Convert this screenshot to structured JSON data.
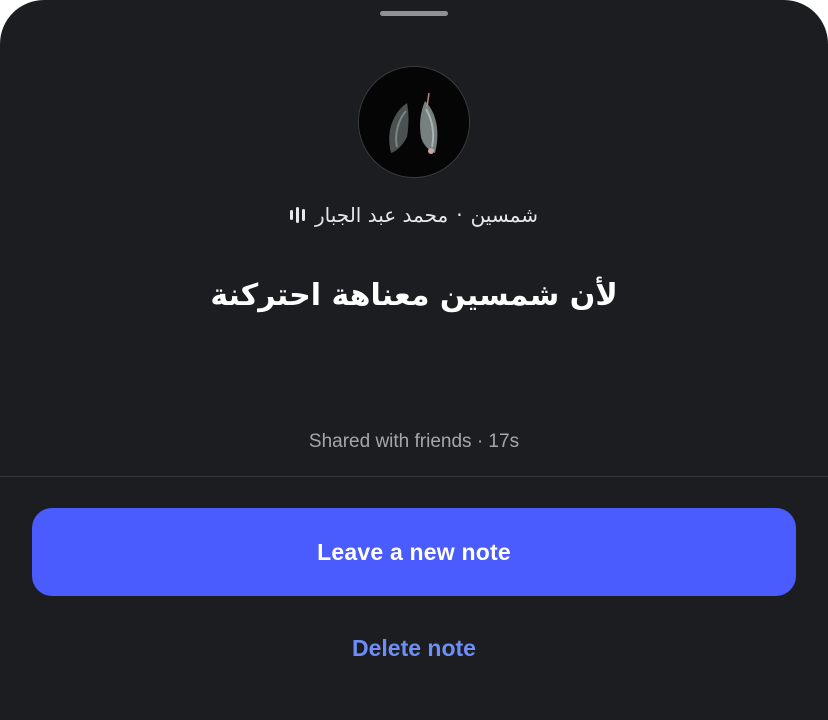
{
  "sheet": {
    "background": "#1b1d20"
  },
  "note": {
    "song_title": "شمسين",
    "separator": "·",
    "artist": "محمد عبد الجبار",
    "music_icon": "music-bars-icon",
    "text": "لأن شمسين معناهة احتركنة",
    "meta": "Shared with friends · 17s"
  },
  "actions": {
    "leave_new_note": "Leave a new note",
    "delete_note": "Delete note"
  },
  "colors": {
    "primary": "#4a5cfd",
    "link": "#6f8df7",
    "text_secondary": "#a3a7ad"
  }
}
